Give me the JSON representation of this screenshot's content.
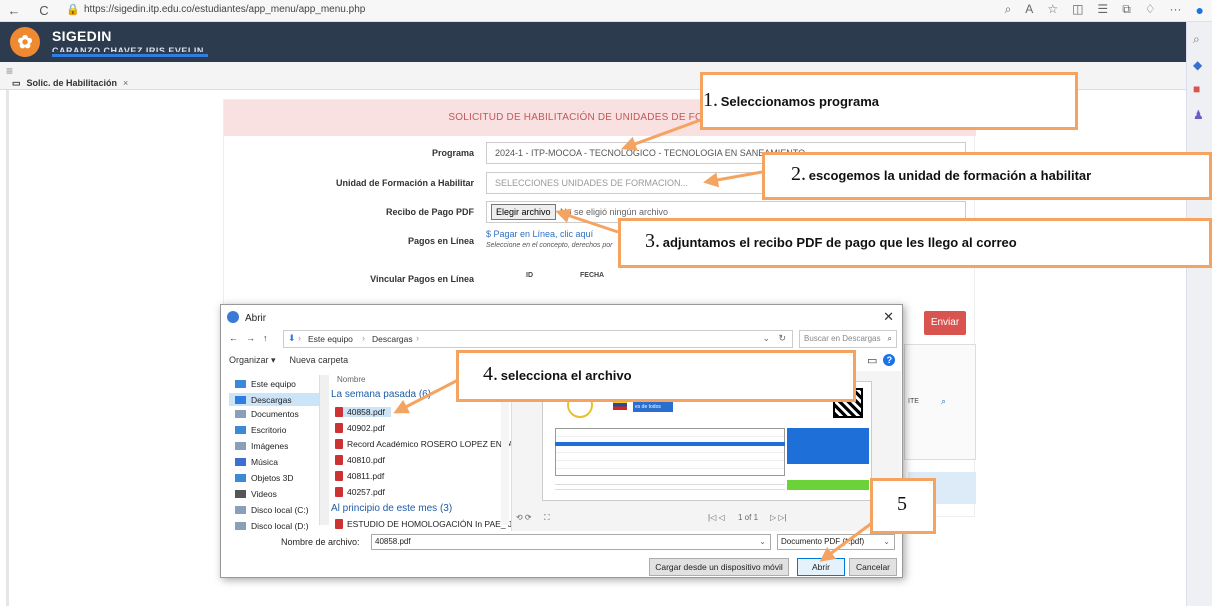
{
  "browser": {
    "url": "https://sigedin.itp.edu.co/estudiantes/app_menu/app_menu.php",
    "back": "←",
    "reload": "C"
  },
  "app": {
    "title": "SIGEDIN",
    "user": "CARANZO CHAVEZ IRIS EVELIN",
    "tab_label": "Solic. de Habilitación",
    "tab_close": "×"
  },
  "form": {
    "title": "SOLICITUD DE HABILITACIÓN DE UNIDADES DE FORMACIÓN",
    "programa_label": "Programa",
    "programa_value": "2024-1 - ITP-MOCOA - TECNOLOGICO - TECNOLOGIA EN SANEAMIENTO",
    "unidad_label": "Unidad de Formación a Habilitar",
    "unidad_placeholder": "SELECCIONES UNIDADES DE FORMACION...",
    "recibo_label": "Recibo de Pago PDF",
    "file_button": "Elegir archivo",
    "file_status": "No se eligió ningún archivo",
    "pagos_label": "Pagos en Línea",
    "pagos_link": "$ Pagar en Línea, clic aquí",
    "pagos_sub": "Seleccione en el concepto, derechos por",
    "vincular_label": "Vincular Pagos en Línea",
    "col_id": "ID",
    "col_fecha": "FECHA",
    "enviar": "Enviar",
    "te_fragment": "ITE"
  },
  "dialog": {
    "title": "Abrir",
    "crumbs": [
      "Este equipo",
      "Descargas"
    ],
    "search_placeholder": "Buscar en Descargas",
    "organize": "Organizar ▾",
    "new_folder": "Nueva carpeta",
    "nav": [
      {
        "label": "Este equipo",
        "color": "#3b8ad8"
      },
      {
        "label": "Descargas",
        "color": "#2f7de1"
      },
      {
        "label": "Documentos",
        "color": "#8aa0b8"
      },
      {
        "label": "Escritorio",
        "color": "#3b8ad8"
      },
      {
        "label": "Imágenes",
        "color": "#8aa0b8"
      },
      {
        "label": "Música",
        "color": "#3b6fd0"
      },
      {
        "label": "Objetos 3D",
        "color": "#3b8ad8"
      },
      {
        "label": "Videos",
        "color": "#555"
      },
      {
        "label": "Disco local (C:)",
        "color": "#8aa0b8"
      },
      {
        "label": "Disco local (D:)",
        "color": "#8aa0b8"
      }
    ],
    "col_name": "Nombre",
    "group1": "La semana pasada (6)",
    "group2": "Al principio de este mes (3)",
    "files1": [
      "40858.pdf",
      "40902.pdf",
      "Record Académico ROSERO LOPEZ ENNAR DANILO",
      "40810.pdf",
      "40811.pdf",
      "40257.pdf"
    ],
    "files2": [
      "ESTUDIO DE HOMOLOGACIÓN In PAE_ Juan felipe l"
    ],
    "page_info": "1 of 1",
    "filename_label": "Nombre de archivo:",
    "filename_value": "40858.pdf",
    "filetype": "Documento PDF (*.pdf)",
    "load_mobile": "Cargar desde un dispositivo móvil",
    "open": "Abrir",
    "cancel": "Cancelar"
  },
  "preview_doc": {
    "badge": "La educación es de todos"
  },
  "annotations": {
    "c1_num": "1.",
    "c1_text": "Seleccionamos programa",
    "c2_num": "2.",
    "c2_text": "escogemos la unidad de formación a habilitar",
    "c3_num": "3.",
    "c3_text": "adjuntamos el recibo PDF de pago que les llego al correo",
    "c4_num": "4.",
    "c4_text": "selecciona el archivo",
    "c5_num": "5"
  }
}
